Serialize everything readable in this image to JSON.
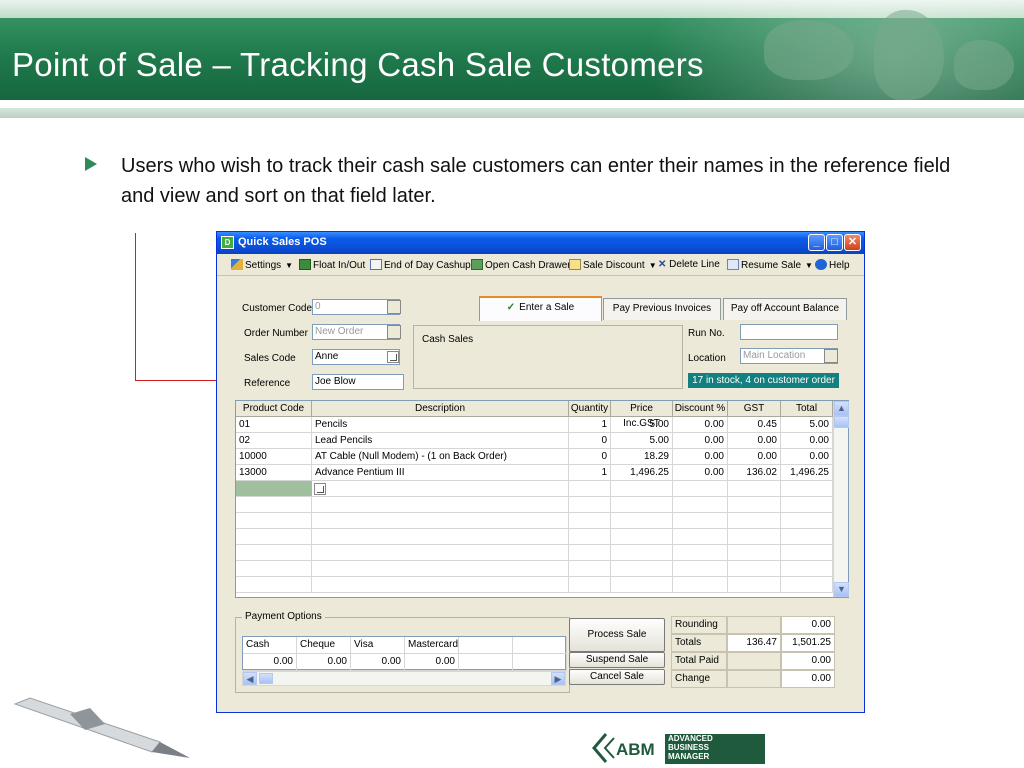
{
  "slide": {
    "title": "Point of Sale – Tracking Cash Sale Customers",
    "bullet": "Users who wish to track their cash sale customers can enter their names in the reference field and view and sort on that field later."
  },
  "window": {
    "title": "Quick Sales POS",
    "toolbar": {
      "settings": "Settings",
      "float": "Float In/Out",
      "end_of_day": "End of Day Cashup",
      "open_drawer": "Open Cash Drawer",
      "sale_discount": "Sale Discount",
      "delete_line": "Delete Line",
      "resume_sale": "Resume Sale",
      "help": "Help"
    },
    "form": {
      "customer_code_label": "Customer Code",
      "customer_code_value": "0",
      "order_number_label": "Order Number",
      "order_number_placeholder": "New Order",
      "sales_code_label": "Sales Code",
      "sales_code_value": "Anne",
      "reference_label": "Reference",
      "reference_value": "Joe Blow",
      "cash_sales": "Cash Sales",
      "run_no_label": "Run No.",
      "run_no_value": "",
      "location_label": "Location",
      "location_placeholder": "Main Location",
      "stock_status": "17 in stock, 4 on customer order"
    },
    "tabs": [
      {
        "label": "Enter a Sale"
      },
      {
        "label": "Pay Previous Invoices"
      },
      {
        "label": "Pay off Account Balance"
      }
    ],
    "grid": {
      "columns": [
        "Product Code",
        "Description",
        "Quantity",
        "Price Inc.GST",
        "Discount %",
        "GST",
        "Total"
      ],
      "rows": [
        [
          "01",
          "Pencils",
          "1",
          "5.00",
          "0.00",
          "0.45",
          "5.00"
        ],
        [
          "02",
          "Lead Pencils",
          "0",
          "5.00",
          "0.00",
          "0.00",
          "0.00"
        ],
        [
          "10000",
          "AT Cable (Null Modem) - (1 on Back Order)",
          "0",
          "18.29",
          "0.00",
          "0.00",
          "0.00"
        ],
        [
          "13000",
          "Advance  Pentium III",
          "1",
          "1,496.25",
          "0.00",
          "136.02",
          "1,496.25"
        ]
      ]
    },
    "payment": {
      "legend": "Payment Options",
      "columns": [
        "Cash",
        "Cheque",
        "Visa",
        "Mastercard",
        "",
        ""
      ],
      "values": [
        "0.00",
        "0.00",
        "0.00",
        "0.00",
        "",
        ""
      ]
    },
    "buttons": {
      "process_sale": "Process Sale",
      "suspend_sale": "Suspend Sale",
      "cancel_sale": "Cancel Sale"
    },
    "totals": {
      "rounding_label": "Rounding",
      "rounding_value": "0.00",
      "totals_label": "Totals",
      "totals_gst": "136.47",
      "totals_value": "1,501.25",
      "total_paid_label": "Total Paid",
      "total_paid_value": "0.00",
      "change_label": "Change",
      "change_value": "0.00"
    }
  },
  "footer": {
    "logo_mark": "ABM",
    "logo_line1": "ADVANCED",
    "logo_line2": "BUSINESS",
    "logo_line3": "MANAGER"
  }
}
